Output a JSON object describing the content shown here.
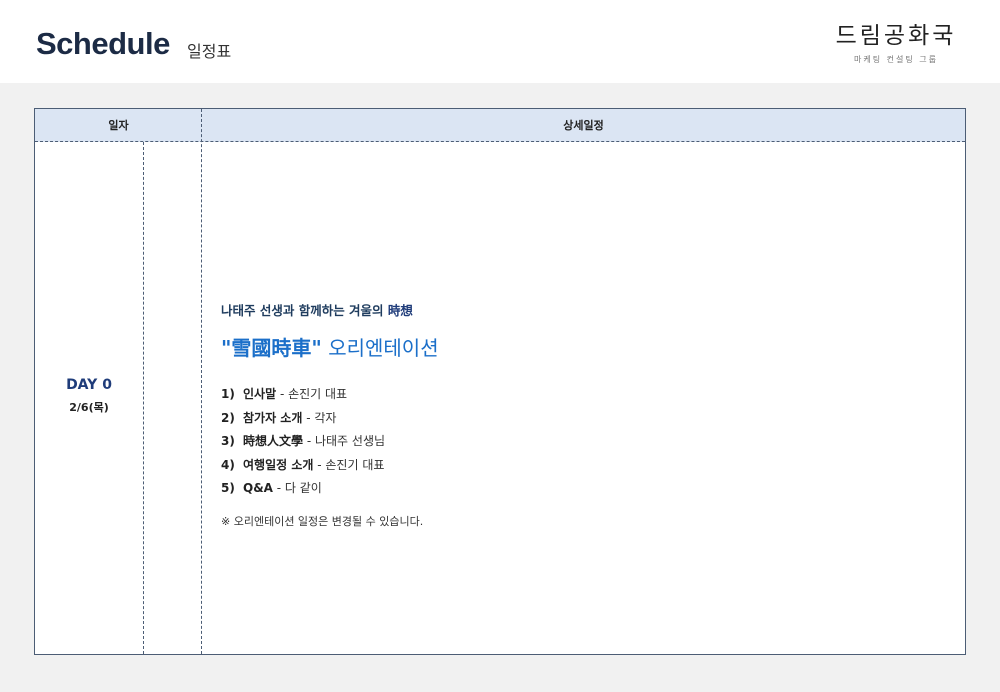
{
  "header": {
    "title": "Schedule",
    "subtitle": "일정표",
    "brand_name": "드림공화국",
    "brand_tagline": "마케팅 컨설팅 그룹"
  },
  "table": {
    "col_date": "일자",
    "col_detail": "상세일정",
    "day": {
      "label": "DAY 0",
      "date": "2/6(목)"
    },
    "detail": {
      "intro_text": "나태주 선생과 함께하는 겨울의 ",
      "intro_highlight": "時想",
      "headline_quoted": "\"雪國時車\"",
      "headline_rest": " 오리엔테이션",
      "agenda": [
        {
          "num": "1)",
          "title": "인사말",
          "desc": " - 손진기 대표"
        },
        {
          "num": "2)",
          "title": "참가자 소개",
          "desc": " - 각자"
        },
        {
          "num": "3)",
          "title": "時想人文學",
          "desc": " - 나태주 선생님"
        },
        {
          "num": "4)",
          "title": "여행일정 소개",
          "desc": " - 손진기 대표"
        },
        {
          "num": "5)",
          "title": "Q&A",
          "desc": " - 다 같이"
        }
      ],
      "note": "※ 오리엔테이션 일정은 변경될 수 있습니다."
    }
  },
  "colors": {
    "title": "#1c2b45",
    "header_bg": "#dbe5f3",
    "border": "#4c5d75",
    "day_label": "#1f3c7a",
    "headline": "#1b6fc9"
  }
}
